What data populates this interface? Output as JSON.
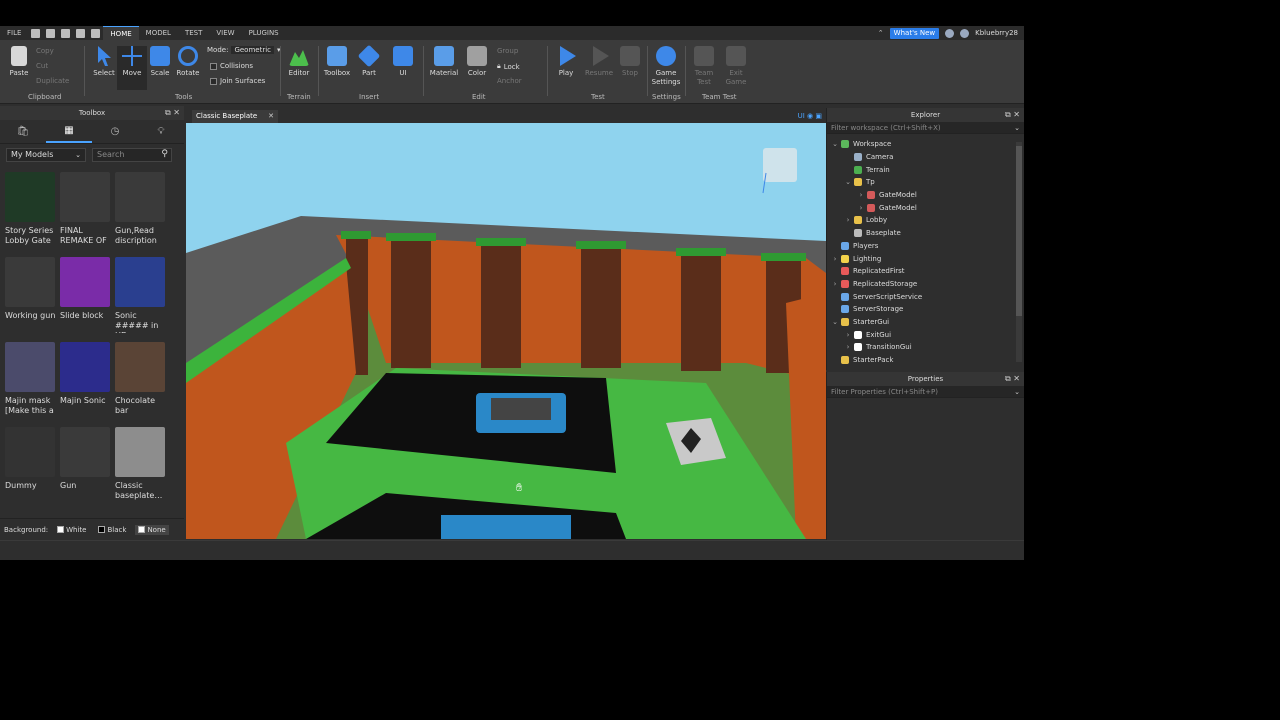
{
  "menu": {
    "file": "FILE",
    "tabs": [
      "HOME",
      "MODEL",
      "TEST",
      "VIEW",
      "PLUGINS"
    ],
    "whats_new": "What's New",
    "username": "Kbluebrry28"
  },
  "ribbon": {
    "clipboard": {
      "paste": "Paste",
      "copy": "Copy",
      "cut": "Cut",
      "duplicate": "Duplicate",
      "label": "Clipboard"
    },
    "tools": {
      "select": "Select",
      "move": "Move",
      "scale": "Scale",
      "rotate": "Rotate",
      "mode_label": "Mode:",
      "mode_value": "Geometric",
      "collisions": "Collisions",
      "join_surfaces": "Join Surfaces",
      "label": "Tools"
    },
    "terrain": {
      "editor": "Editor",
      "label": "Terrain"
    },
    "insert": {
      "toolbox": "Toolbox",
      "part": "Part",
      "ui": "UI",
      "label": "Insert"
    },
    "edit": {
      "material": "Material",
      "color": "Color",
      "group": "Group",
      "lock": "Lock",
      "anchor": "Anchor",
      "label": "Edit"
    },
    "test": {
      "play": "Play",
      "resume": "Resume",
      "stop": "Stop",
      "label": "Test"
    },
    "settings": {
      "game_settings": "Game Settings",
      "label": "Settings"
    },
    "team_test": {
      "team_test": "Team Test",
      "exit_game": "Exit Game",
      "label": "Team Test"
    }
  },
  "toolbox": {
    "title": "Toolbox",
    "category": "My Models",
    "search_placeholder": "Search",
    "items": [
      {
        "title": "Story Series Lobby Gate",
        "color": "#1f3a26"
      },
      {
        "title": "FINAL REMAKE OF",
        "color": "#3a3a3a"
      },
      {
        "title": "Gun,Read discription",
        "color": "#3a3a3a"
      },
      {
        "title": "Working gun",
        "color": "#3a3a3a"
      },
      {
        "title": "Slide block",
        "color": "#7a2ca8"
      },
      {
        "title": "Sonic ##### in HD",
        "color": "#2a3f8f"
      },
      {
        "title": "Majin mask [Make this a",
        "color": "#4b4b6b"
      },
      {
        "title": "Majin Sonic",
        "color": "#2c2c8c"
      },
      {
        "title": "Chocolate bar",
        "color": "#5a4436"
      },
      {
        "title": "Dummy",
        "color": "#333333"
      },
      {
        "title": "Gun",
        "color": "#3a3a3a"
      },
      {
        "title": "Classic baseplate…",
        "color": "#8d8d8d"
      }
    ],
    "background_label": "Background:",
    "bg_white": "White",
    "bg_black": "Black",
    "bg_none": "None"
  },
  "document": {
    "tab_title": "Classic Baseplate",
    "ui_toggle": "UI"
  },
  "explorer": {
    "title": "Explorer",
    "filter_placeholder": "Filter workspace (Ctrl+Shift+X)",
    "nodes": [
      {
        "label": "Workspace",
        "indent": 0,
        "arrow": "⌄",
        "icon": "#5cb85c"
      },
      {
        "label": "Camera",
        "indent": 1,
        "arrow": "",
        "icon": "#9ab0c8"
      },
      {
        "label": "Terrain",
        "indent": 1,
        "arrow": "",
        "icon": "#4caf50"
      },
      {
        "label": "Tp",
        "indent": 1,
        "arrow": "⌄",
        "icon": "#e8c14a"
      },
      {
        "label": "GateModel",
        "indent": 2,
        "arrow": "›",
        "icon": "#d45a5a"
      },
      {
        "label": "GateModel",
        "indent": 2,
        "arrow": "›",
        "icon": "#d45a5a"
      },
      {
        "label": "Lobby",
        "indent": 1,
        "arrow": "›",
        "icon": "#e8c14a"
      },
      {
        "label": "Baseplate",
        "indent": 1,
        "arrow": "",
        "icon": "#bcbcbc"
      },
      {
        "label": "Players",
        "indent": 0,
        "arrow": "",
        "icon": "#6aa7e8"
      },
      {
        "label": "Lighting",
        "indent": 0,
        "arrow": "›",
        "icon": "#f2d24b"
      },
      {
        "label": "ReplicatedFirst",
        "indent": 0,
        "arrow": "",
        "icon": "#e85a5a"
      },
      {
        "label": "ReplicatedStorage",
        "indent": 0,
        "arrow": "›",
        "icon": "#e85a5a"
      },
      {
        "label": "ServerScriptService",
        "indent": 0,
        "arrow": "",
        "icon": "#6aa7e8"
      },
      {
        "label": "ServerStorage",
        "indent": 0,
        "arrow": "",
        "icon": "#6aa7e8"
      },
      {
        "label": "StarterGui",
        "indent": 0,
        "arrow": "⌄",
        "icon": "#e8c14a"
      },
      {
        "label": "ExitGui",
        "indent": 1,
        "arrow": "›",
        "icon": "#ffffff"
      },
      {
        "label": "TransitionGui",
        "indent": 1,
        "arrow": "›",
        "icon": "#ffffff"
      },
      {
        "label": "StarterPack",
        "indent": 0,
        "arrow": "",
        "icon": "#e8c14a"
      }
    ]
  },
  "properties": {
    "title": "Properties",
    "filter_placeholder": "Filter Properties (Ctrl+Shift+P)"
  }
}
